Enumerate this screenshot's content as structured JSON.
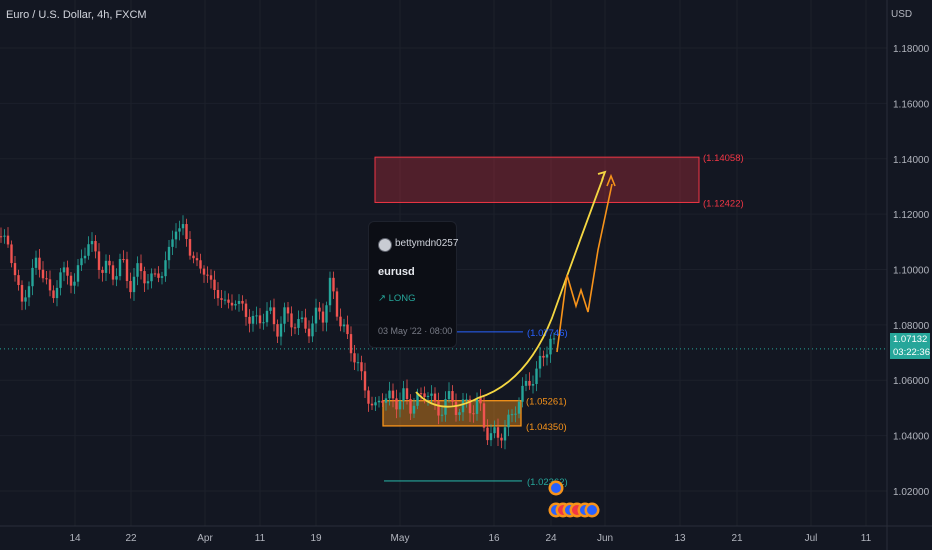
{
  "header": {
    "title": "Euro / U.S. Dollar, 4h, FXCM"
  },
  "currency": "USD",
  "colors": {
    "bg": "#131722",
    "up": "#26a69a",
    "down": "#ef5350",
    "target": "#f23645",
    "zone": "#f7931a",
    "path": "#f5d742",
    "level": "#2962ff"
  },
  "idea": {
    "author": "bettymdn0257",
    "symbol": "eurusd",
    "direction": "↗ LONG",
    "published": "03 May '22 · 08:00"
  },
  "price": {
    "last": "1.07132",
    "countdown": "03:22:36"
  },
  "chart_data": {
    "type": "candlestick",
    "title": "Euro / U.S. Dollar, 4h, FXCM",
    "ylabel": "USD",
    "ylim": [
      1.005,
      1.195
    ],
    "y_ticks": [
      "1.18000",
      "1.16000",
      "1.14000",
      "1.12000",
      "1.10000",
      "1.08000",
      "1.06000",
      "1.04000",
      "1.02000"
    ],
    "x_ticks": [
      "14",
      "22",
      "Apr",
      "11",
      "19",
      "May",
      "16",
      "24",
      "Jun",
      "13",
      "21",
      "Jul",
      "11"
    ],
    "grid": true,
    "levels": [
      {
        "label": "(1.14058)",
        "value": 1.14058,
        "color": "#f23645"
      },
      {
        "label": "(1.12422)",
        "value": 1.12422,
        "color": "#f23645"
      },
      {
        "label": "(1.07746)",
        "value": 1.07746,
        "color": "#2962ff"
      },
      {
        "label": "(1.05261)",
        "value": 1.05261,
        "color": "#f7931a"
      },
      {
        "label": "(1.04350)",
        "value": 1.0435,
        "color": "#f7931a"
      },
      {
        "label": "(1.02362)",
        "value": 1.02362,
        "color": "#26a69a"
      }
    ],
    "target_zone": [
      1.12422,
      1.14058
    ],
    "support_zone": [
      1.0435,
      1.05261
    ],
    "price_path_x": [
      0.8,
      7.5,
      14.5,
      22.0,
      29.5,
      37.0,
      44.0,
      51.5,
      59.0,
      66.0,
      73.5,
      81.0,
      88.0,
      95.5,
      103.0,
      110.0,
      117.5,
      125.0,
      132.0,
      139.5,
      147.0,
      154.0,
      161.5,
      169.0,
      176.0,
      183.5,
      191.0,
      198.0,
      205.5,
      213.0,
      220.0,
      227.5,
      235.0,
      242.0,
      249.5,
      257.0,
      264.0,
      271.5,
      279.0,
      286.0,
      293.5,
      301.0,
      308.0,
      315.5,
      323.0,
      330.0,
      337.5,
      345.0,
      352.0,
      359.5,
      367.0,
      374.0,
      381.5,
      389.0,
      396.0,
      403.5,
      411.0,
      418.0,
      425.5,
      433.0,
      440.0,
      447.5,
      455.0,
      462.0,
      469.5,
      477.0,
      484.0,
      491.5,
      499.0,
      506.0,
      513.5,
      521.0,
      528.0,
      535.5,
      543.0,
      550.0,
      557.0
    ],
    "price_path_close": [
      1.112,
      1.109,
      1.1,
      1.087,
      1.096,
      1.104,
      1.097,
      1.09,
      1.096,
      1.101,
      1.093,
      1.104,
      1.11,
      1.105,
      1.101,
      1.098,
      1.102,
      1.099,
      1.095,
      1.1,
      1.097,
      1.096,
      1.1,
      1.105,
      1.117,
      1.113,
      1.107,
      1.1,
      1.1,
      1.093,
      1.09,
      1.087,
      1.089,
      1.086,
      1.083,
      1.08,
      1.085,
      1.082,
      1.079,
      1.084,
      1.081,
      1.08,
      1.079,
      1.082,
      1.085,
      1.093,
      1.086,
      1.076,
      1.071,
      1.064,
      1.054,
      1.05,
      1.053,
      1.055,
      1.051,
      1.055,
      1.05,
      1.053,
      1.057,
      1.052,
      1.048,
      1.054,
      1.051,
      1.049,
      1.052,
      1.05,
      1.046,
      1.038,
      1.041,
      1.043,
      1.048,
      1.056,
      1.058,
      1.063,
      1.068,
      1.075,
      1.071
    ]
  }
}
